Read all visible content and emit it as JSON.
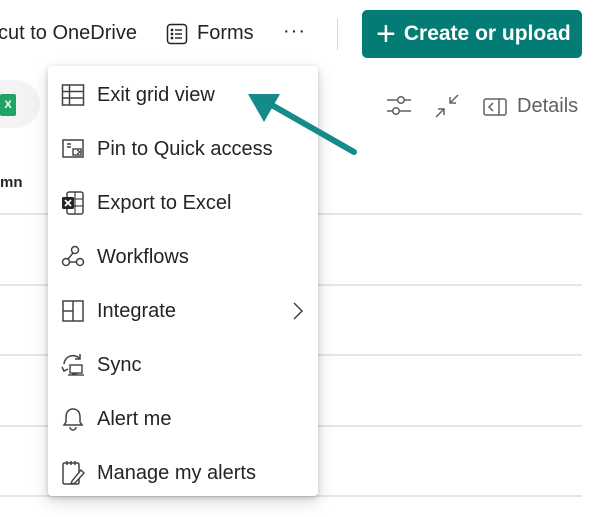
{
  "command_bar": {
    "shortcut_label": "cut to OneDrive",
    "forms_label": "Forms",
    "more_label": "···",
    "create_label": "Create or upload"
  },
  "view_bar": {
    "details_label": "Details",
    "excel_badge": "X"
  },
  "list": {
    "column_header": "mn"
  },
  "menu": {
    "items": [
      {
        "label": "Exit grid view",
        "icon": "grid-icon"
      },
      {
        "label": "Pin to Quick access",
        "icon": "pin-icon"
      },
      {
        "label": "Export to Excel",
        "icon": "excel-icon"
      },
      {
        "label": "Workflows",
        "icon": "workflows-icon"
      },
      {
        "label": "Integrate",
        "icon": "integrate-icon",
        "has_submenu": true
      },
      {
        "label": "Sync",
        "icon": "sync-icon"
      },
      {
        "label": "Alert me",
        "icon": "bell-icon"
      },
      {
        "label": "Manage my alerts",
        "icon": "manage-alerts-icon"
      }
    ]
  },
  "colors": {
    "accent": "#037c75",
    "arrow": "#168a8a"
  }
}
